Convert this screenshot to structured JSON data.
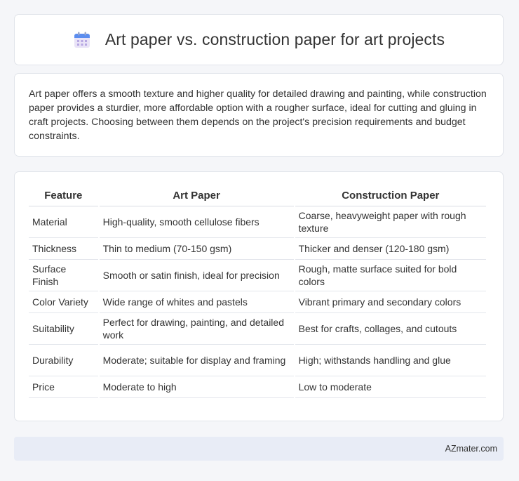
{
  "header": {
    "title": "Art paper vs. construction paper for art projects",
    "icon": "calendar-icon"
  },
  "summary": {
    "text": "Art paper offers a smooth texture and higher quality for detailed drawing and painting, while construction paper provides a sturdier, more affordable option with a rougher surface, ideal for cutting and gluing in craft projects. Choosing between them depends on the project's precision requirements and budget constraints."
  },
  "table": {
    "headers": [
      "Feature",
      "Art Paper",
      "Construction Paper"
    ],
    "rows": [
      [
        "Material",
        "High-quality, smooth cellulose fibers",
        "Coarse, heavyweight paper with rough texture"
      ],
      [
        "Thickness",
        "Thin to medium (70-150 gsm)",
        "Thicker and denser (120-180 gsm)"
      ],
      [
        "Surface Finish",
        "Smooth or satin finish, ideal for precision",
        "Rough, matte surface suited for bold colors"
      ],
      [
        "Color Variety",
        "Wide range of whites and pastels",
        "Vibrant primary and secondary colors"
      ],
      [
        "Suitability",
        "Perfect for drawing, painting, and detailed work",
        "Best for crafts, collages, and cutouts"
      ],
      [
        "Durability",
        "Moderate; suitable for display and framing",
        "High; withstands handling and glue"
      ],
      [
        "Price",
        "Moderate to high",
        "Low to moderate"
      ]
    ]
  },
  "footer": {
    "brand": "AZmater.com"
  }
}
